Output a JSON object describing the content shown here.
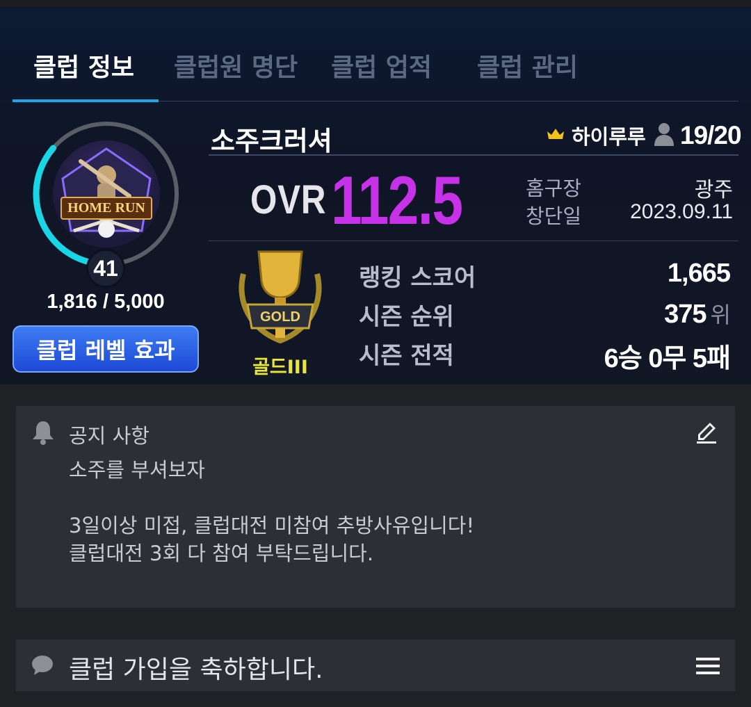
{
  "tabs": [
    {
      "label": "클럽 정보",
      "active": true
    },
    {
      "label": "클럽원 명단",
      "active": false
    },
    {
      "label": "클럽 업적",
      "active": false
    },
    {
      "label": "클럽 관리",
      "active": false
    }
  ],
  "club": {
    "emblem_text": "HOME RUN",
    "level": "41",
    "exp": "1,816 / 5,000",
    "exp_progress": 0.3632,
    "level_button": "클럽 레벨 효과",
    "name": "소주크러셔",
    "leader": "하이루루",
    "members": "19/20",
    "ovr_label": "OVR",
    "ovr_value": "112.5",
    "home_label": "홈구장",
    "home_value": "광주",
    "founded_label": "창단일",
    "founded_value": "2023.09.11"
  },
  "tier": {
    "label": "골드III",
    "emblem_text": "GOLD"
  },
  "stats": {
    "ranking_label": "랭킹 스코어",
    "ranking_value": "1,665",
    "season_rank_label": "시즌 순위",
    "season_rank_value": "375",
    "season_rank_unit": "위",
    "season_record_label": "시즌 전적",
    "season_record_value": "6승 0무 5패"
  },
  "notice": {
    "title": "공지 사항",
    "body": "소주를 부셔보자\n\n3일이상 미접, 클럽대전 미참여 추방사유입니다!\n클럽대전 3회 다 참여 부탁드립니다."
  },
  "chat": {
    "text": "클럽 가입을 축하합니다."
  },
  "colors": {
    "accent": "#1ea6e8",
    "ovr": "#c732e8",
    "tier": "#e9e53a",
    "button": "#1d49d6"
  },
  "icons": [
    "crown-icon",
    "person-icon",
    "bell-icon",
    "edit-icon",
    "chat-icon",
    "menu-icon"
  ]
}
